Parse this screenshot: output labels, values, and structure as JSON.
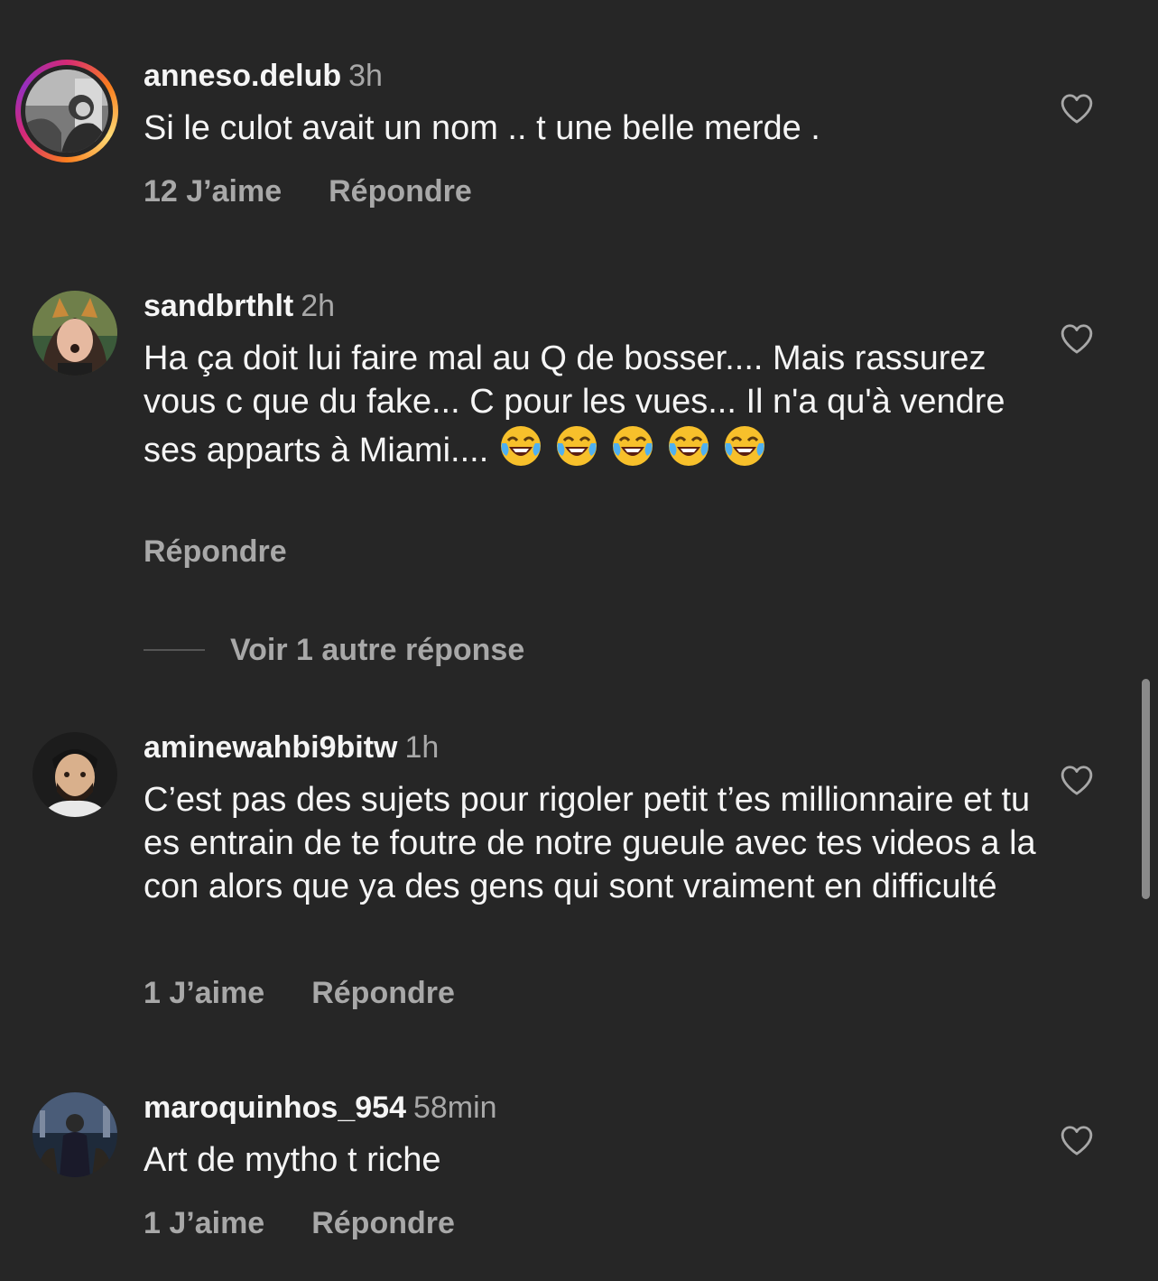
{
  "comments": [
    {
      "username": "anneso.delub",
      "time": "3h",
      "text": "Si le culot avait un nom .. t une belle merde .",
      "likes": "12 J’aime",
      "reply": "Répondre",
      "avatar_icon": "avatar-photo"
    },
    {
      "username": "sandbrthlt",
      "time": "2h",
      "text": "Ha ça doit lui faire mal au Q de bosser.... Mais rassurez vous c que du fake... C pour les vues... Il n'a qu'à vendre ses apparts à Miami....",
      "emoji_icon": "face-with-tears-of-joy-icon",
      "reply": "Répondre",
      "view_replies": "Voir 1 autre réponse",
      "avatar_icon": "avatar-photo"
    },
    {
      "username": "aminewahbi9bitw",
      "time": "1h",
      "text": "C’est pas des sujets pour rigoler petit t’es millionnaire et tu es entrain de te foutre de notre gueule avec tes videos a la con alors que ya des gens qui sont vraiment en difficulté",
      "likes": "1 J’aime",
      "reply": "Répondre",
      "avatar_icon": "avatar-photo"
    },
    {
      "username": "maroquinhos_954",
      "time": "58min",
      "text": "Art de mytho t riche",
      "likes": "1 J’aime",
      "reply": "Répondre",
      "avatar_icon": "avatar-photo"
    }
  ],
  "colors": {
    "background": "#262626",
    "primary_text": "#f5f5f5",
    "secondary_text": "#a8a8a8",
    "story_ring": [
      "#d62976",
      "#fa7e1e",
      "#feda75",
      "#962fbf"
    ]
  }
}
